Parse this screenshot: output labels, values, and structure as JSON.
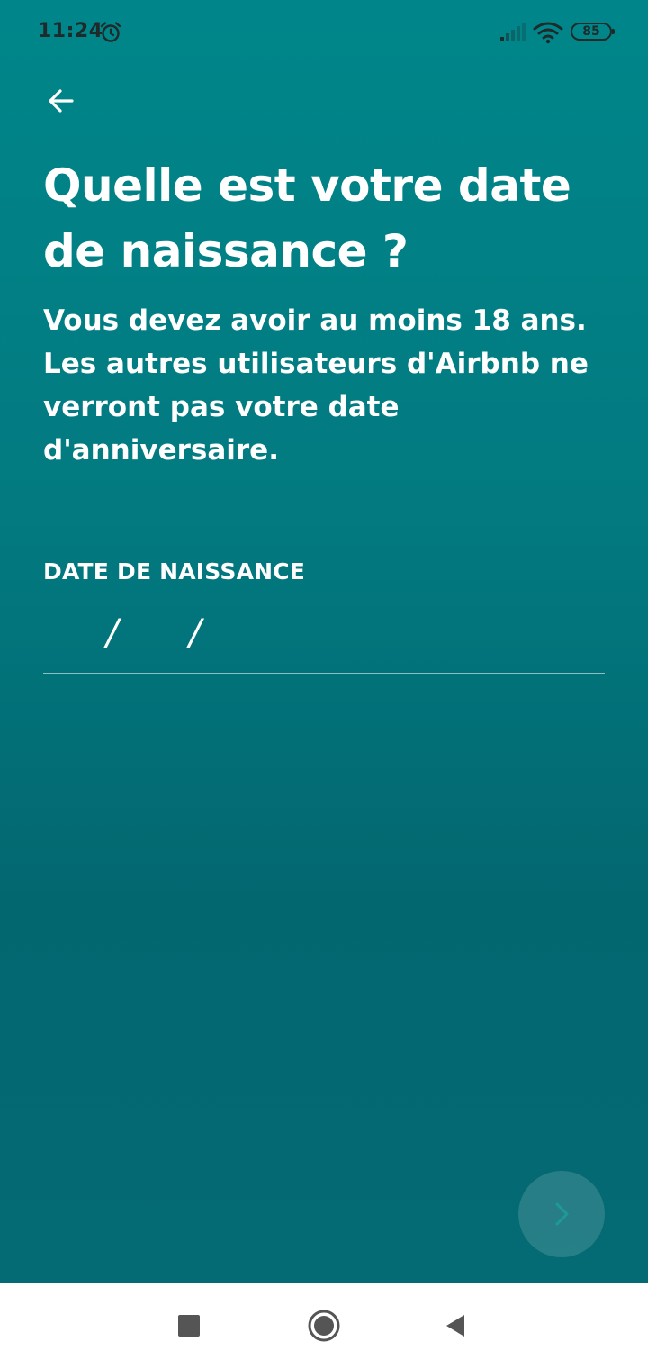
{
  "status_bar": {
    "time": "11:24",
    "battery": "85",
    "icons": [
      "alarm-icon",
      "signal-icon",
      "wifi-icon",
      "battery-icon"
    ]
  },
  "header": {
    "back_icon": "arrow-left-icon"
  },
  "content": {
    "title": "Quelle est votre date de naissance ?",
    "subtitle": "Vous devez avoir au moins 18 ans. Les autres utilisateurs d'Airbnb ne verront pas votre date d'anniversaire.",
    "field_label": "DATE DE NAISSANCE",
    "date_separator": "/"
  },
  "next_button": {
    "icon": "chevron-right-icon"
  },
  "nav_bar": {
    "icons": [
      "square-icon",
      "circle-icon",
      "triangle-back-icon"
    ]
  },
  "colors": {
    "background_top": "#00868a",
    "background_bottom": "#046a74",
    "text": "#ffffff",
    "status_text": "#1f2a2a"
  }
}
